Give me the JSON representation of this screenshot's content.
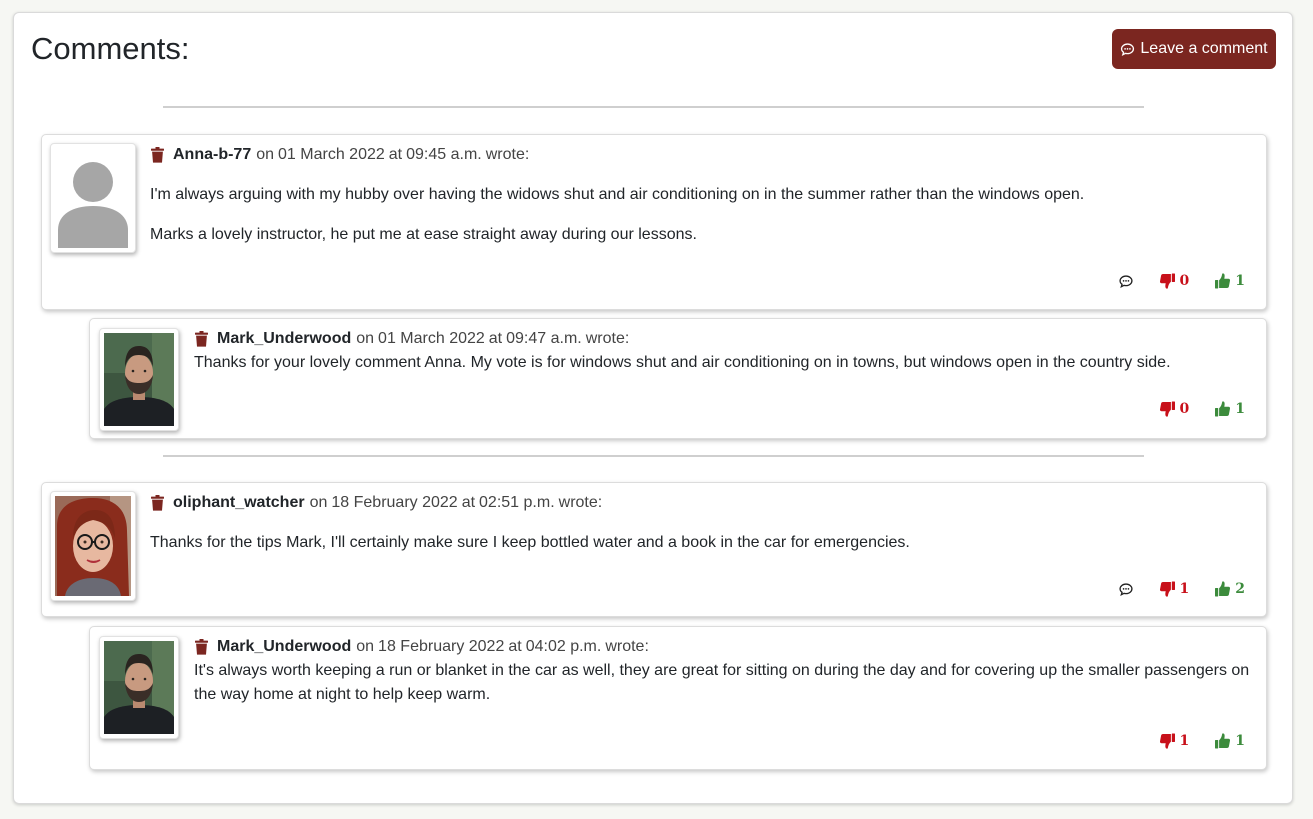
{
  "header": {
    "title": "Comments:",
    "leave_comment_label": "Leave a comment"
  },
  "colors": {
    "accent": "#7b2620",
    "dislike": "#c8101a",
    "like": "#3c8b3c"
  },
  "comments": [
    {
      "author": "Anna-b-77",
      "on_label": "on",
      "date": "01 March 2022",
      "time_prefix": "at",
      "time": "09:45 a.m.",
      "wrote_label": "wrote:",
      "avatar": "default-user-icon",
      "paragraphs": [
        "I'm always arguing with my hubby over having the widows shut and air conditioning on in the summer rather than the windows open.",
        "Marks a lovely instructor, he put me at ease straight away during our lessons."
      ],
      "dislikes": "0",
      "likes": "1",
      "reply": {
        "author": "Mark_Underwood",
        "on_label": "on",
        "date": "01 March 2022",
        "time_prefix": "at",
        "time": "09:47 a.m.",
        "wrote_label": "wrote:",
        "avatar": "bearded-man-photo",
        "text": "Thanks for your lovely comment Anna. My vote is for windows shut and air conditioning on in towns, but windows open in the country side.",
        "dislikes": "0",
        "likes": "1"
      }
    },
    {
      "author": "oliphant_watcher",
      "on_label": "on",
      "date": "18 February 2022",
      "time_prefix": "at",
      "time": "02:51 p.m.",
      "wrote_label": "wrote:",
      "avatar": "woman-glasses-photo",
      "paragraphs": [
        "Thanks for the tips Mark, I'll certainly make sure I keep bottled water and a book in the car for emergencies."
      ],
      "dislikes": "1",
      "likes": "2",
      "reply": {
        "author": "Mark_Underwood",
        "on_label": "on",
        "date": "18 February 2022",
        "time_prefix": "at",
        "time": "04:02 p.m.",
        "wrote_label": "wrote:",
        "avatar": "bearded-man-photo",
        "text": "It's always worth keeping a run or blanket in the car as well, they are great for sitting on during the day and for covering up the smaller passengers on the way home at night to help keep warm.",
        "dislikes": "1",
        "likes": "1"
      }
    }
  ]
}
